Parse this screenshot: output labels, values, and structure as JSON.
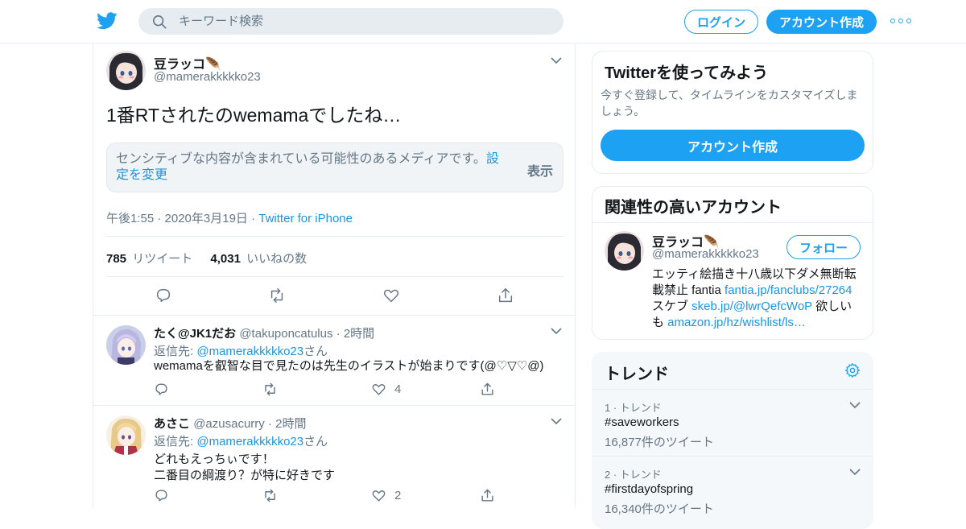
{
  "header": {
    "search_placeholder": "キーワード検索",
    "login": "ログイン",
    "signup": "アカウント作成"
  },
  "tweet": {
    "name": "豆ラッコ🪶",
    "handle": "@mamerakkkkko23",
    "text": "1番RTされたのwemamaでしたね…",
    "sensitive_text": "センシティブな内容が含まれている可能性のあるメディアです。",
    "sensitive_link": "設定を変更",
    "sensitive_show": "表示",
    "time": "午後1:55 · 2020年3月19日 · ",
    "source": "Twitter for iPhone",
    "retweets": "785",
    "retweets_label": "リツイート",
    "likes": "4,031",
    "likes_label": "いいねの数"
  },
  "replies": [
    {
      "name": "たく@JK1だお",
      "handle": "@takuponcatulus",
      "time": "2時間",
      "to_prefix": "返信先: ",
      "to_handle": "@mamerakkkkko23",
      "to_suffix": "さん",
      "text": "wemamaを叡智な目で見たのは先生のイラストが始まりです(@♡▽♡@)",
      "like_count": "4"
    },
    {
      "name": "あさこ",
      "handle": "@azusacurry",
      "time": "2時間",
      "to_prefix": "返信先: ",
      "to_handle": "@mamerakkkkko23",
      "to_suffix": "さん",
      "text_line1": "どれもえっちぃです！",
      "text_line2": "二番目の綱渡り？が特に好きです",
      "like_count": "2"
    }
  ],
  "sidebar": {
    "signup_card": {
      "title": "Twitterを使ってみよう",
      "subtitle": "今すぐ登録して、タイムラインをカスタマイズしましょう。",
      "button": "アカウント作成"
    },
    "related": {
      "title": "関連性の高いアカウント",
      "name": "豆ラッコ🪶",
      "handle": "@mamerakkkkko23",
      "follow": "フォロー",
      "bio_1": "エッティ絵描き十八歳以下ダメ無断転載禁止 fantia ",
      "bio_link1": "fantia.jp/fanclubs/27264",
      "bio_2": " スケブ ",
      "bio_link2": "skeb.jp/@lwrQefcWoP",
      "bio_3": " 欲しいも ",
      "bio_link3": "amazon.jp/hz/wishlist/ls…"
    },
    "trends": {
      "title": "トレンド",
      "items": [
        {
          "rank": "1 · トレンド",
          "tag": "#saveworkers",
          "count": "16,877件のツイート"
        },
        {
          "rank": "2 · トレンド",
          "tag": "#firstdayofspring",
          "count": "16,340件のツイート"
        }
      ]
    }
  },
  "colors": {
    "accent": "#1da1f2",
    "link": "#1b95e0",
    "muted": "#657786",
    "border": "#e6ecf0"
  }
}
